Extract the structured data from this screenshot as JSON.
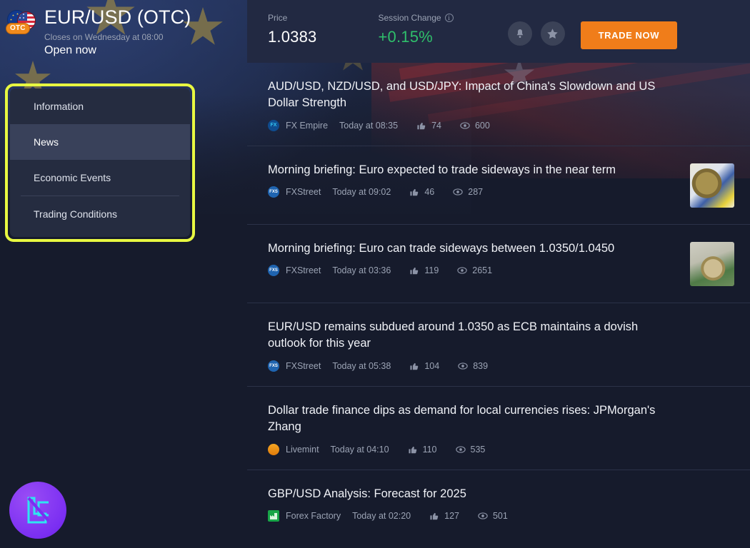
{
  "instrument": {
    "pair_title": "EUR/USD (OTC)",
    "otc_badge": "OTC",
    "closes_text": "Closes on Wednesday at 08:00",
    "status": "Open now"
  },
  "menu": {
    "items": [
      {
        "label": "Information",
        "active": false
      },
      {
        "label": "News",
        "active": true
      },
      {
        "label": "Economic Events",
        "active": false
      },
      {
        "label": "Trading Conditions",
        "active": false
      }
    ]
  },
  "header": {
    "price_label": "Price",
    "price_value": "1.0383",
    "change_label": "Session Change",
    "change_value": "+0.15%",
    "change_color": "#2fbf6b",
    "info_icon": "info-icon",
    "bell_icon": "bell-icon",
    "star_icon": "star-icon",
    "trade_button": "TRADE NOW",
    "trade_button_color": "#f07d1a"
  },
  "logo": {
    "name": "lc-brand-logo",
    "color": "#7b2ff2"
  },
  "news": {
    "items": [
      {
        "title": "AUD/USD, NZD/USD, and USD/JPY: Impact of China's Slowdown and US Dollar Strength",
        "source": "FX Empire",
        "source_icon": "fxempire",
        "time": "Today at 08:35",
        "likes": "74",
        "views": "600",
        "thumb": ""
      },
      {
        "title": "Morning briefing: Euro expected to trade sideways in the near term",
        "source": "FXStreet",
        "source_icon": "fxstreet",
        "time": "Today at 09:02",
        "likes": "46",
        "views": "287",
        "thumb": "coin-eu"
      },
      {
        "title": "Morning briefing: Euro can trade sideways between 1.0350/1.0450",
        "source": "FXStreet",
        "source_icon": "fxstreet",
        "time": "Today at 03:36",
        "likes": "119",
        "views": "2651",
        "thumb": "coin-dollar"
      },
      {
        "title": "EUR/USD remains subdued around 1.0350 as ECB maintains a dovish outlook for this year",
        "source": "FXStreet",
        "source_icon": "fxstreet",
        "time": "Today at 05:38",
        "likes": "104",
        "views": "839",
        "thumb": ""
      },
      {
        "title": "Dollar trade finance dips as demand for local currencies rises: JPMorgan's Zhang",
        "source": "Livemint",
        "source_icon": "livemint",
        "time": "Today at 04:10",
        "likes": "110",
        "views": "535",
        "thumb": ""
      },
      {
        "title": "GBP/USD Analysis: Forecast for 2025",
        "source": "Forex Factory",
        "source_icon": "forexfactory",
        "time": "Today at 02:20",
        "likes": "127",
        "views": "501",
        "thumb": ""
      }
    ]
  }
}
